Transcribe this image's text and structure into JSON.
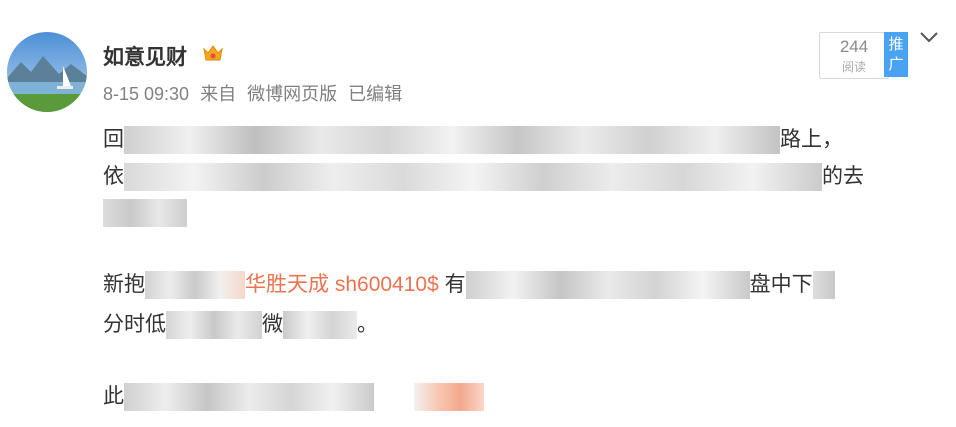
{
  "post": {
    "author": "如意见财",
    "time": "8-15 09:30",
    "source_prefix": "来自",
    "source": "微博网页版",
    "edited": "已编辑",
    "read_count": "244",
    "read_label": "阅读",
    "promote_label_1": "推",
    "promote_label_2": "广"
  },
  "content": {
    "p1_l1_a": "回",
    "p1_l1_b": "路上，",
    "p1_l2_a": "依",
    "p1_l2_b": "的去",
    "p2_l1_a": "新抱",
    "stock_link": "华胜天成 sh600410$",
    "p2_l1_b": "有",
    "p2_l1_c": "盘中下",
    "p2_l2_a": "分时低",
    "p2_l2_b": "微",
    "p2_l2_c": "。",
    "p3_l1_a": "此"
  },
  "icons": {
    "crown": "crown-badge-icon",
    "chevron": "chevron-down-icon"
  },
  "colors": {
    "link": "#eb7350",
    "promote": "#4aa3f2"
  }
}
